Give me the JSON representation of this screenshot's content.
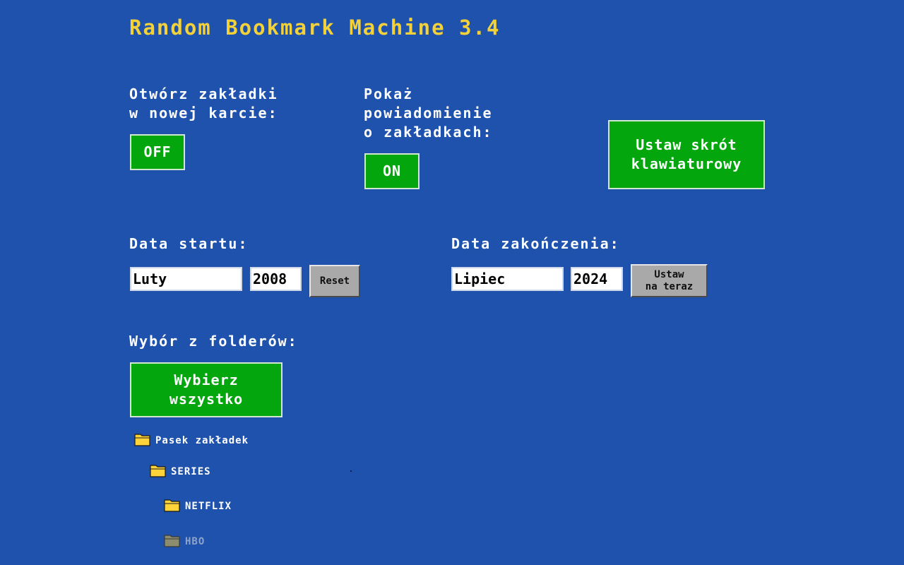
{
  "app": {
    "title": "Random Bookmark Machine 3.4"
  },
  "options": {
    "open_new_tab_label": "Otwórz zakładki\nw nowej karcie:",
    "open_new_tab_value": "OFF",
    "show_notification_label": "Pokaż\npowiadomienie\no zakładkach:",
    "show_notification_value": "ON",
    "shortcut_button_label": "Ustaw skrót\nklawiaturowy"
  },
  "dates": {
    "start_label": "Data startu:",
    "start_month": "Luty",
    "start_year": "2008",
    "reset_label": "Reset",
    "end_label": "Data zakończenia:",
    "end_month": "Lipiec",
    "end_year": "2024",
    "set_now_label": "Ustaw\nna teraz"
  },
  "folders": {
    "section_label": "Wybór z folderów:",
    "select_all_label": "Wybierz\nwszystko",
    "tree": [
      {
        "name": "Pasek zakładek",
        "state": "selected",
        "color": "#ffd43b"
      },
      {
        "name": "SERIES",
        "state": "selected",
        "color": "#ffd43b"
      },
      {
        "name": "NETFLIX",
        "state": "selected",
        "color": "#ffd43b"
      },
      {
        "name": "HBO",
        "state": "unselected",
        "color": "#8c8c6e"
      }
    ]
  },
  "colors": {
    "background": "#1f52ad",
    "title": "#f2d13a",
    "button_green": "#03a70d",
    "button_gray": "#a9a9a9"
  }
}
